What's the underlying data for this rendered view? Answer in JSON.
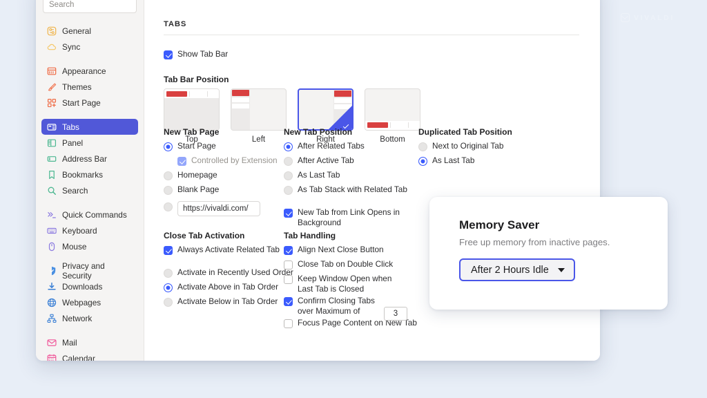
{
  "watermark": {
    "brand": "VIVALDI",
    "icon": "vivaldi-logo-icon"
  },
  "sidebar": {
    "search": {
      "placeholder": "Search",
      "value": ""
    },
    "groups": [
      {
        "items": [
          {
            "label": "General",
            "icon": "general-icon",
            "color": "#f0b44a",
            "selected": false
          },
          {
            "label": "Sync",
            "icon": "sync-cloud-icon",
            "color": "#f5c86a",
            "selected": false
          }
        ]
      },
      {
        "items": [
          {
            "label": "Appearance",
            "icon": "appearance-icon",
            "color": "#ef6b45",
            "selected": false
          },
          {
            "label": "Themes",
            "icon": "themes-brush-icon",
            "color": "#f0714c",
            "selected": false
          },
          {
            "label": "Start Page",
            "icon": "start-page-icon",
            "color": "#ef6b45",
            "selected": false
          }
        ]
      },
      {
        "items": [
          {
            "label": "Tabs",
            "icon": "tabs-icon",
            "color": "#ffffff",
            "selected": true
          },
          {
            "label": "Panel",
            "icon": "panel-icon",
            "color": "#4eb892",
            "selected": false
          },
          {
            "label": "Address Bar",
            "icon": "address-bar-icon",
            "color": "#4eb892",
            "selected": false
          },
          {
            "label": "Bookmarks",
            "icon": "bookmark-icon",
            "color": "#4eb892",
            "selected": false
          },
          {
            "label": "Search",
            "icon": "search-icon",
            "color": "#4eb892",
            "selected": false
          }
        ]
      },
      {
        "items": [
          {
            "label": "Quick Commands",
            "icon": "quick-commands-icon",
            "color": "#8b7ae0",
            "selected": false
          },
          {
            "label": "Keyboard",
            "icon": "keyboard-icon",
            "color": "#8b7ae0",
            "selected": false
          },
          {
            "label": "Mouse",
            "icon": "mouse-icon",
            "color": "#8b7ae0",
            "selected": false
          }
        ]
      },
      {
        "items": [
          {
            "label": "Privacy and Security",
            "icon": "shield-icon",
            "color": "#4a90e2",
            "selected": false
          },
          {
            "label": "Downloads",
            "icon": "download-icon",
            "color": "#3a7fd5",
            "selected": false
          },
          {
            "label": "Webpages",
            "icon": "globe-icon",
            "color": "#3a7fd5",
            "selected": false
          },
          {
            "label": "Network",
            "icon": "network-icon",
            "color": "#3a7fd5",
            "selected": false
          }
        ]
      },
      {
        "items": [
          {
            "label": "Mail",
            "icon": "mail-icon",
            "color": "#f05a9b",
            "selected": false
          },
          {
            "label": "Calendar",
            "icon": "calendar-icon",
            "color": "#f05a9b",
            "selected": false
          }
        ]
      }
    ]
  },
  "main": {
    "section_title": "TABS",
    "show_tab_bar": {
      "label": "Show Tab Bar",
      "checked": true
    },
    "tab_bar_position": {
      "label": "Tab Bar Position",
      "options": [
        {
          "label": "Top",
          "selected": false
        },
        {
          "label": "Left",
          "selected": false
        },
        {
          "label": "Right",
          "selected": true
        },
        {
          "label": "Bottom",
          "selected": false
        }
      ]
    },
    "new_tab_page": {
      "label": "New Tab Page",
      "options": [
        {
          "label": "Start Page",
          "selected": true
        },
        {
          "label": "Homepage",
          "selected": false
        },
        {
          "label": "Blank Page",
          "selected": false
        }
      ],
      "controlled_by_extension": {
        "label": "Controlled by Extension",
        "checked": true,
        "disabled": true
      },
      "custom_url": {
        "value": "https://vivaldi.com/",
        "selected": false
      }
    },
    "new_tab_position": {
      "label": "New Tab Position",
      "options": [
        {
          "label": "After Related Tabs",
          "selected": true
        },
        {
          "label": "After Active Tab",
          "selected": false
        },
        {
          "label": "As Last Tab",
          "selected": false
        },
        {
          "label": "As Tab Stack with Related Tab",
          "selected": false
        }
      ],
      "background_open": {
        "label": "New Tab from Link Opens in Background",
        "checked": true
      }
    },
    "duplicated_tab_position": {
      "label": "Duplicated Tab Position",
      "options": [
        {
          "label": "Next to Original Tab",
          "selected": false
        },
        {
          "label": "As Last Tab",
          "selected": true
        }
      ]
    },
    "close_tab_activation": {
      "label": "Close Tab Activation",
      "always_activate": {
        "label": "Always Activate Related Tab",
        "checked": true
      },
      "options": [
        {
          "label": "Activate in Recently Used Order",
          "selected": false
        },
        {
          "label": "Activate Above in Tab Order",
          "selected": true
        },
        {
          "label": "Activate Below in Tab Order",
          "selected": false
        }
      ]
    },
    "tab_handling": {
      "label": "Tab Handling",
      "items": [
        {
          "label": "Align Next Close Button",
          "checked": true
        },
        {
          "label": "Close Tab on Double Click",
          "checked": false
        },
        {
          "label": "Keep Window Open when Last Tab is Closed",
          "checked": false
        },
        {
          "label": "Confirm Closing Tabs over Maximum of",
          "checked": true
        },
        {
          "label": "Focus Page Content on New Tab",
          "checked": false
        }
      ],
      "max_tabs_value": "3"
    }
  },
  "memory_saver": {
    "title": "Memory Saver",
    "subtitle": "Free up memory from inactive pages.",
    "select_value": "After 2 Hours Idle",
    "accent": "#4a56e8"
  }
}
